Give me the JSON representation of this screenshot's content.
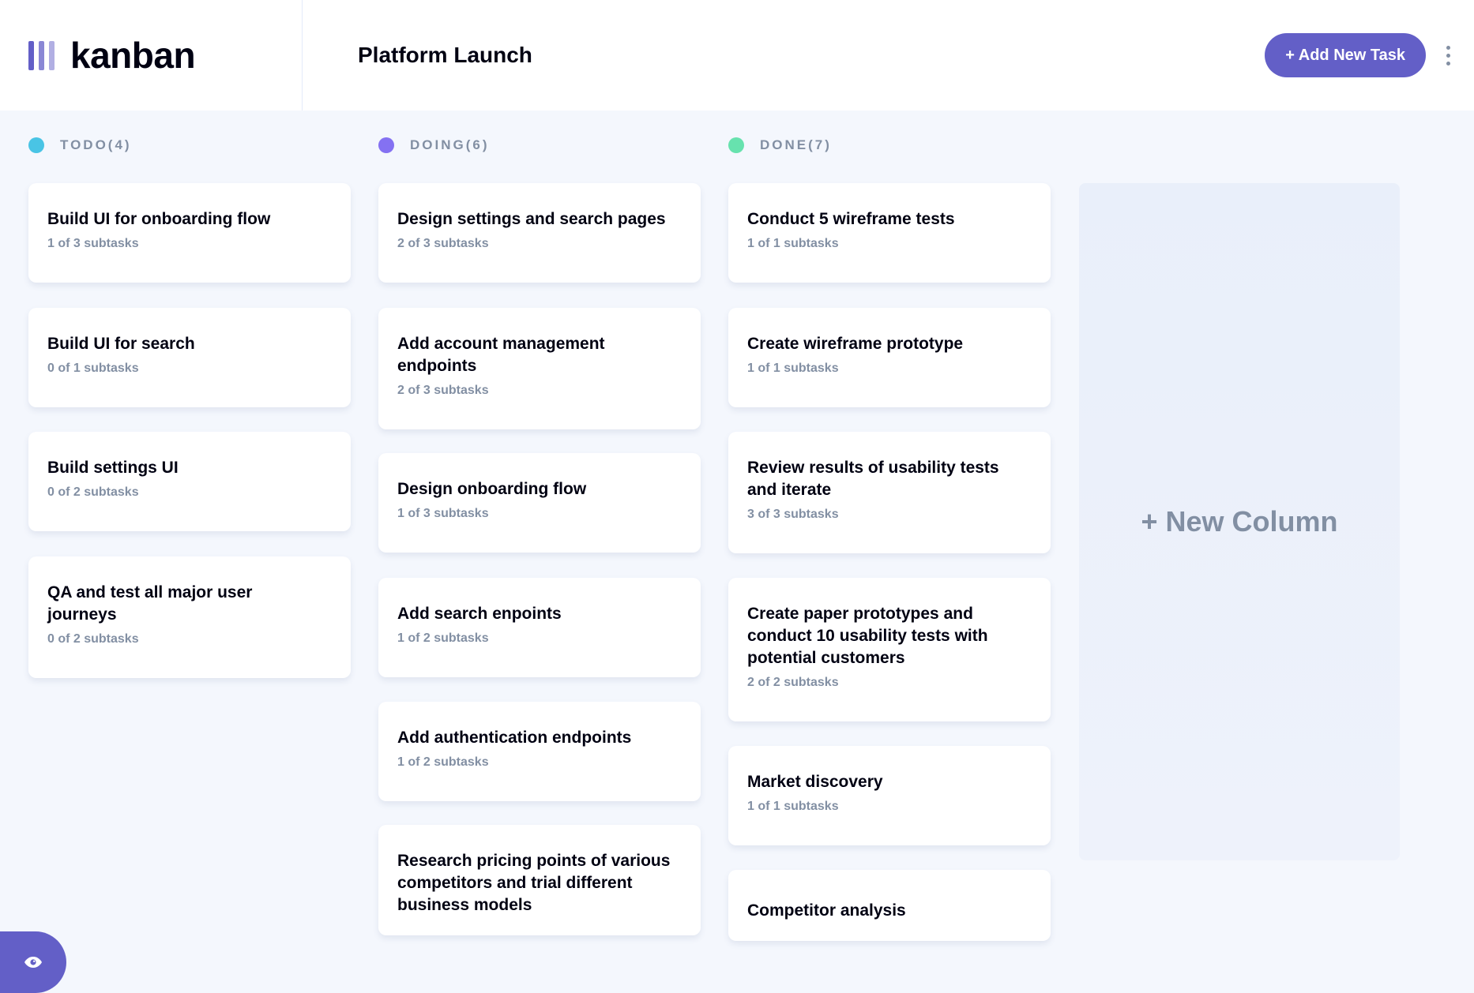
{
  "app": {
    "name": "kanban"
  },
  "board": {
    "title": "Platform Launch"
  },
  "header": {
    "add_task_label": "+ Add New Task"
  },
  "columns": [
    {
      "header": "TODO(4)",
      "color": "#49C4E5",
      "tasks": [
        {
          "title": "Build UI for onboarding flow",
          "subtasks": "1 of 3 subtasks"
        },
        {
          "title": "Build UI for search",
          "subtasks": "0 of 1 subtasks"
        },
        {
          "title": "Build settings UI",
          "subtasks": "0 of 2 subtasks"
        },
        {
          "title": "QA and test all major user journeys",
          "subtasks": "0 of 2 subtasks"
        }
      ]
    },
    {
      "header": "DOING(6)",
      "color": "#8471F2",
      "tasks": [
        {
          "title": "Design settings and search pages",
          "subtasks": "2 of 3 subtasks"
        },
        {
          "title": "Add account management endpoints",
          "subtasks": "2 of 3 subtasks"
        },
        {
          "title": "Design onboarding flow",
          "subtasks": "1 of 3 subtasks"
        },
        {
          "title": "Add search enpoints",
          "subtasks": "1 of 2 subtasks"
        },
        {
          "title": "Add authentication endpoints",
          "subtasks": "1 of 2 subtasks"
        },
        {
          "title": "Research pricing points of various competitors and trial different business models",
          "subtasks": ""
        }
      ]
    },
    {
      "header": "DONE(7)",
      "color": "#67E2AE",
      "tasks": [
        {
          "title": "Conduct 5 wireframe tests",
          "subtasks": "1 of 1 subtasks"
        },
        {
          "title": "Create wireframe prototype",
          "subtasks": "1 of 1 subtasks"
        },
        {
          "title": "Review results of usability tests and iterate",
          "subtasks": "3 of 3 subtasks"
        },
        {
          "title": "Create paper prototypes and conduct 10 usability tests with potential customers",
          "subtasks": "2 of 2 subtasks"
        },
        {
          "title": "Market discovery",
          "subtasks": "1 of 1 subtasks"
        },
        {
          "title": "Competitor analysis",
          "subtasks": ""
        }
      ]
    }
  ],
  "new_column_label": "+ New Column",
  "colors": {
    "accent": "#635FC7",
    "background": "#F4F7FD",
    "muted": "#828FA3"
  },
  "icons": {
    "logo": "kanban-bars-icon",
    "more": "vertical-ellipsis-icon",
    "sidebar_toggle": "eye-icon"
  }
}
